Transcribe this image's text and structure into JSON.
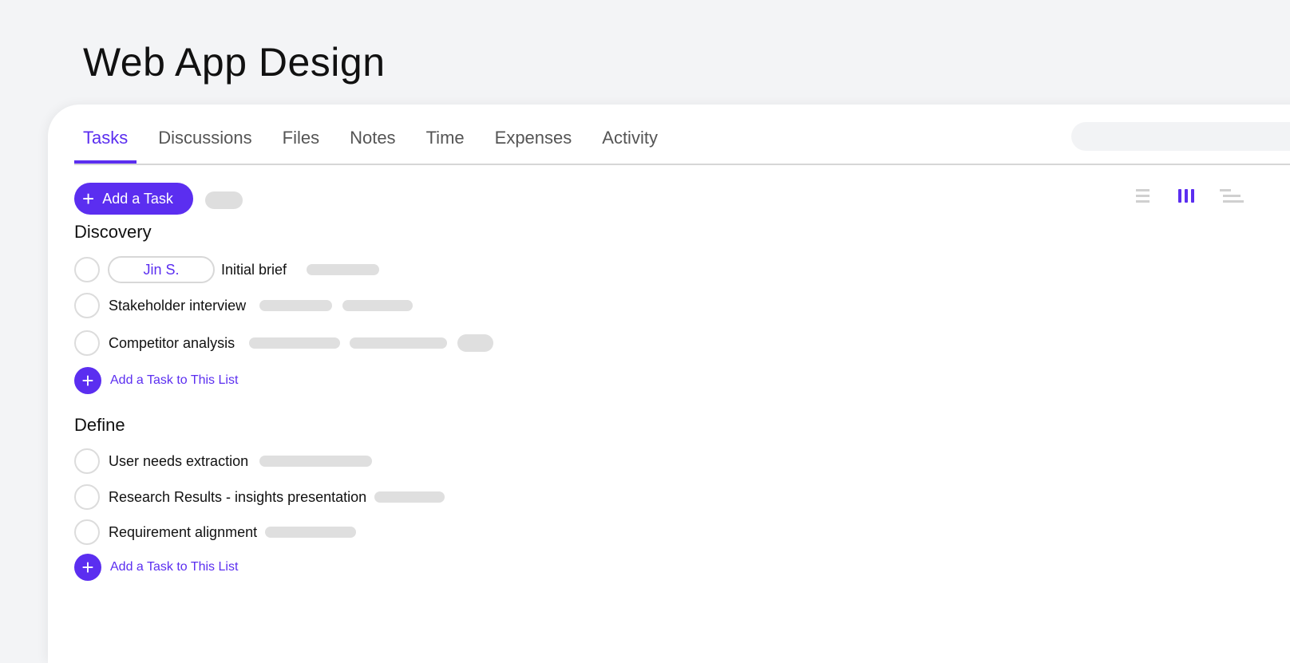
{
  "page": {
    "title": "Web App Design"
  },
  "tabs": [
    {
      "label": "Tasks",
      "active": true
    },
    {
      "label": "Discussions"
    },
    {
      "label": "Files"
    },
    {
      "label": "Notes"
    },
    {
      "label": "Time"
    },
    {
      "label": "Expenses"
    },
    {
      "label": "Activity"
    }
  ],
  "toolbar": {
    "add_task_label": "Add a Task",
    "add_icon": "plus-icon",
    "views": [
      "list-view-icon",
      "board-view-icon",
      "gantt-view-icon"
    ],
    "active_view": "board-view-icon"
  },
  "lists": [
    {
      "title": "Discovery",
      "tasks": [
        {
          "assignee": "Jin S.",
          "name": "Initial brief"
        },
        {
          "name": "Stakeholder interview"
        },
        {
          "name": "Competitor analysis"
        }
      ],
      "add_label": "Add a Task to This List"
    },
    {
      "title": "Define",
      "tasks": [
        {
          "name": "User needs extraction"
        },
        {
          "name": "Research Results - insights presentation"
        },
        {
          "name": "Requirement alignment"
        }
      ],
      "add_label": "Add a Task to This List"
    }
  ],
  "colors": {
    "accent": "#5b2ef0",
    "placeholder": "#dfdfdf",
    "background": "#f3f4f6"
  }
}
